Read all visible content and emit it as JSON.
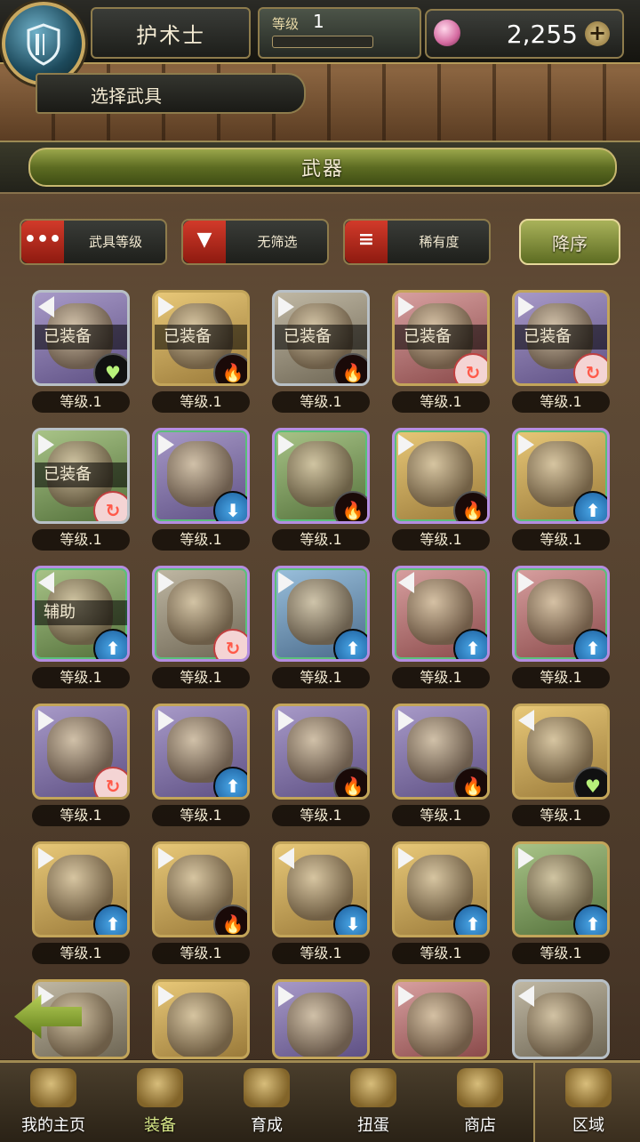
{
  "header": {
    "class_name": "护术士",
    "level_label": "等级",
    "level_value": "1",
    "exp_progress": 0.0,
    "gems": "2,255",
    "gems_plus": "+"
  },
  "subheader": {
    "title": "选择武具"
  },
  "weapon_tab": {
    "title": "武器"
  },
  "filters": {
    "sort_level": {
      "icon": "•••",
      "label": "武具等级"
    },
    "filter": {
      "icon": "▼",
      "label": "无筛选"
    },
    "rarity": {
      "icon": "≡",
      "label": "稀有度"
    },
    "order_button": "降序"
  },
  "items": [
    {
      "equipped": "已装备",
      "level": "等级.1",
      "bg": "purple",
      "frame": "silver",
      "badge": "heart",
      "arrow": "left"
    },
    {
      "equipped": "已装备",
      "level": "等级.1",
      "bg": "gold",
      "frame": "gold",
      "badge": "fire",
      "arrow": "right"
    },
    {
      "equipped": "已装备",
      "level": "等级.1",
      "bg": "grey",
      "frame": "silver",
      "badge": "fire",
      "arrow": "right"
    },
    {
      "equipped": "已装备",
      "level": "等级.1",
      "bg": "red",
      "frame": "gold",
      "badge": "swirl",
      "arrow": "right"
    },
    {
      "equipped": "已装备",
      "level": "等级.1",
      "bg": "purple",
      "frame": "gold",
      "badge": "swirl",
      "arrow": "right"
    },
    {
      "equipped": "已装备",
      "level": "等级.1",
      "bg": "green",
      "frame": "silver",
      "badge": "swirl",
      "arrow": "right"
    },
    {
      "equipped": "",
      "level": "等级.1",
      "bg": "purple",
      "frame": "rainbow",
      "badge": "down",
      "arrow": "right"
    },
    {
      "equipped": "",
      "level": "等级.1",
      "bg": "green",
      "frame": "rainbow",
      "badge": "fire",
      "arrow": "right"
    },
    {
      "equipped": "",
      "level": "等级.1",
      "bg": "gold",
      "frame": "rainbow",
      "badge": "fire",
      "arrow": "right"
    },
    {
      "equipped": "",
      "level": "等级.1",
      "bg": "gold",
      "frame": "rainbow",
      "badge": "up",
      "arrow": "right"
    },
    {
      "equipped": "辅助",
      "level": "等级.1",
      "bg": "green",
      "frame": "rainbow",
      "badge": "up",
      "arrow": "left"
    },
    {
      "equipped": "",
      "level": "等级.1",
      "bg": "grey",
      "frame": "rainbow",
      "badge": "swirl",
      "arrow": "right"
    },
    {
      "equipped": "",
      "level": "等级.1",
      "bg": "blue",
      "frame": "rainbow",
      "badge": "up",
      "arrow": "right"
    },
    {
      "equipped": "",
      "level": "等级.1",
      "bg": "red",
      "frame": "rainbow",
      "badge": "up",
      "arrow": "left"
    },
    {
      "equipped": "",
      "level": "等级.1",
      "bg": "red",
      "frame": "rainbow",
      "badge": "up",
      "arrow": "right"
    },
    {
      "equipped": "",
      "level": "等级.1",
      "bg": "purple",
      "frame": "gold",
      "badge": "swirl",
      "arrow": "right"
    },
    {
      "equipped": "",
      "level": "等级.1",
      "bg": "purple",
      "frame": "gold",
      "badge": "up",
      "arrow": "right"
    },
    {
      "equipped": "",
      "level": "等级.1",
      "bg": "purple",
      "frame": "gold",
      "badge": "fire",
      "arrow": "right"
    },
    {
      "equipped": "",
      "level": "等级.1",
      "bg": "purple",
      "frame": "gold",
      "badge": "fire",
      "arrow": "right"
    },
    {
      "equipped": "",
      "level": "等级.1",
      "bg": "gold",
      "frame": "gold",
      "badge": "heart",
      "arrow": "left"
    },
    {
      "equipped": "",
      "level": "等级.1",
      "bg": "gold",
      "frame": "gold",
      "badge": "up",
      "arrow": "right"
    },
    {
      "equipped": "",
      "level": "等级.1",
      "bg": "gold",
      "frame": "gold",
      "badge": "fire",
      "arrow": "right"
    },
    {
      "equipped": "",
      "level": "等级.1",
      "bg": "gold",
      "frame": "gold",
      "badge": "down",
      "arrow": "left"
    },
    {
      "equipped": "",
      "level": "等级.1",
      "bg": "gold",
      "frame": "gold",
      "badge": "up",
      "arrow": "right"
    },
    {
      "equipped": "",
      "level": "等级.1",
      "bg": "green",
      "frame": "gold",
      "badge": "up",
      "arrow": "right"
    },
    {
      "equipped": "",
      "level": "",
      "bg": "grey",
      "frame": "gold",
      "badge": "",
      "arrow": "right"
    },
    {
      "equipped": "",
      "level": "",
      "bg": "gold",
      "frame": "gold",
      "badge": "",
      "arrow": "right"
    },
    {
      "equipped": "",
      "level": "",
      "bg": "purple",
      "frame": "gold",
      "badge": "",
      "arrow": "right"
    },
    {
      "equipped": "",
      "level": "",
      "bg": "red",
      "frame": "gold",
      "badge": "",
      "arrow": "right"
    },
    {
      "equipped": "",
      "level": "",
      "bg": "grey",
      "frame": "silver",
      "badge": "",
      "arrow": "left"
    }
  ],
  "nav": [
    {
      "label": "我的主页",
      "icon": "scroll-icon"
    },
    {
      "label": "装备",
      "icon": "helmet-icon"
    },
    {
      "label": "育成",
      "icon": "sword-icon"
    },
    {
      "label": "扭蛋",
      "icon": "gacha-icon"
    },
    {
      "label": "商店",
      "icon": "coin-icon"
    },
    {
      "label": "区域",
      "icon": "globe-icon"
    }
  ]
}
